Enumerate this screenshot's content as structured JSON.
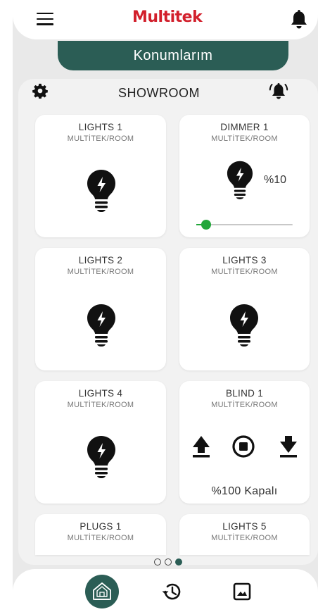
{
  "header": {
    "logo_text": "Multitek",
    "menu_icon": "hamburger-menu-icon",
    "notification_icon": "bell-icon"
  },
  "location": {
    "title": "Konumlarım"
  },
  "room": {
    "name": "SHOWROOM",
    "settings_icon": "gear-icon",
    "alarm_icon": "bell-ring-icon"
  },
  "devices": [
    {
      "title": "LIGHTS 1",
      "subtitle": "MULTİTEK/ROOM",
      "type": "light"
    },
    {
      "title": "DIMMER 1",
      "subtitle": "MULTİTEK/ROOM",
      "type": "dimmer",
      "level_text": "%10",
      "level": 0.1
    },
    {
      "title": "LIGHTS 2",
      "subtitle": "MULTİTEK/ROOM",
      "type": "light"
    },
    {
      "title": "LIGHTS 3",
      "subtitle": "MULTİTEK/ROOM",
      "type": "light"
    },
    {
      "title": "LIGHTS 4",
      "subtitle": "MULTİTEK/ROOM",
      "type": "light"
    },
    {
      "title": "BLIND 1",
      "subtitle": "MULTİTEK/ROOM",
      "type": "blind",
      "status": "%100 Kapalı"
    },
    {
      "title": "PLUGS 1",
      "subtitle": "MULTİTEK/ROOM",
      "type": "plug"
    },
    {
      "title": "LIGHTS 5",
      "subtitle": "MULTİTEK/ROOM",
      "type": "light"
    }
  ],
  "pager": {
    "count": 3,
    "active_index": 2
  },
  "bottom_nav": [
    {
      "name": "home",
      "icon": "home-icon",
      "active": true
    },
    {
      "name": "history",
      "icon": "history-icon",
      "active": false
    },
    {
      "name": "gallery",
      "icon": "image-icon",
      "active": false
    }
  ],
  "colors": {
    "brand_red": "#d21f2b",
    "accent_green": "#2b5d55",
    "slider_green": "#22a63a"
  }
}
